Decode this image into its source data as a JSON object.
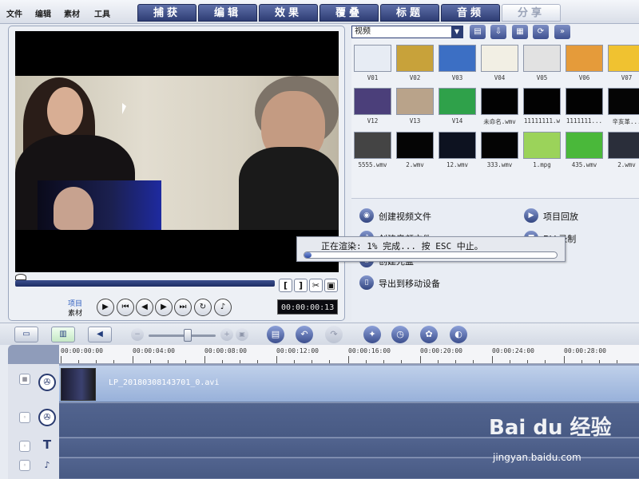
{
  "menu": [
    "文件",
    "编辑",
    "素材",
    "工具"
  ],
  "tabs": [
    {
      "label": "捕获",
      "active": false
    },
    {
      "label": "编辑",
      "active": false
    },
    {
      "label": "效果",
      "active": false
    },
    {
      "label": "覆叠",
      "active": false
    },
    {
      "label": "标题",
      "active": false
    },
    {
      "label": "音频",
      "active": false
    },
    {
      "label": "分享",
      "active": true
    }
  ],
  "preview": {
    "mode_project": "项目",
    "mode_clip": "素材",
    "timecode": "00:00:00:13",
    "trim_start": "[",
    "trim_end": "]"
  },
  "library": {
    "category": "视频",
    "thumbs": [
      [
        "V01",
        "V02",
        "V03",
        "V04",
        "V05",
        "V06",
        "V07"
      ],
      [
        "V12",
        "V13",
        "V14",
        "未命名.wmv",
        "11111111.w",
        "1111111...",
        "辛亥革..."
      ],
      [
        "5555.wmv",
        "2.wmv",
        "12.wmv",
        "333.wmv",
        "1.mpg",
        "435.wmv",
        "2.wmv"
      ]
    ]
  },
  "share": {
    "create_video": "创建视频文件",
    "create_audio": "创建音频文件",
    "create_disc": "创建光盘",
    "export_mobile": "导出到移动设备",
    "project_playback": "项目回放",
    "dv_record": "DV 录制"
  },
  "render": {
    "text": "正在渲染: 1% 完成... 按 ESC 中止。",
    "percent": 1
  },
  "timeline": {
    "ruler": [
      "00:00:00:00",
      "00:00:04:00",
      "00:00:08:00",
      "00:00:12:00",
      "00:00:16:00",
      "00:00:20:00",
      "00:00:24:00",
      "00:00:28:00"
    ],
    "clip_name": "LP_20180308143701_0.avi"
  },
  "watermark": {
    "brand": "Bai du 经验",
    "url": "jingyan.baidu.com"
  }
}
